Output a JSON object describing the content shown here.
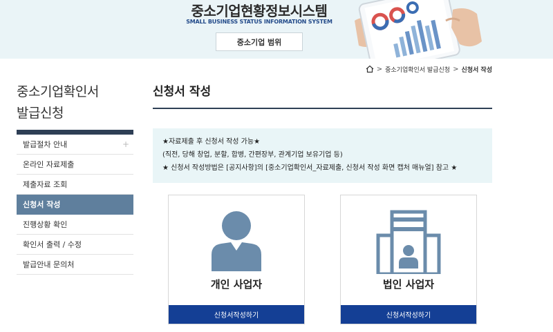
{
  "banner": {
    "title": "중소기업현황정보시스템",
    "subtitle": "SMALL BUSINESS STATUS INFORMATION SYSTEM",
    "scope_button": "중소기업 범위"
  },
  "breadcrumb": {
    "items": [
      "중소기업확인서 발급신청",
      "신청서 작성"
    ],
    "separator": ">"
  },
  "sidebar": {
    "title_line1": "중소기업확인서",
    "title_line2": "발급신청",
    "items": [
      {
        "label": "발급절차 안내",
        "has_plus": true
      },
      {
        "label": "온라인 자료제출"
      },
      {
        "label": "제출자료 조회"
      },
      {
        "label": "신청서 작성",
        "active": true
      },
      {
        "label": "진행상황 확인"
      },
      {
        "label": "확인서 출력 / 수정"
      },
      {
        "label": "발급안내 문의처"
      }
    ],
    "plus_glyph": "+"
  },
  "main": {
    "page_title": "신청서 작성",
    "notice": {
      "line1": "★자료제출 후 신청서 작성 가능★",
      "line2": "(직전, 당해 창업, 분할, 합병, 간편장부, 관계기업 보유기업 등)",
      "line3": "★ 신청서 작성방법은 [공지사항]의 [중소기업확인서_자료제출, 신청서 작성 화면 캡처 매뉴얼] 참고 ★"
    },
    "cards": [
      {
        "label": "개인 사업자",
        "button": "신청서작성하기",
        "icon": "person-icon"
      },
      {
        "label": "법인 사업자",
        "button": "신청서작성하기",
        "icon": "building-icon"
      }
    ]
  },
  "colors": {
    "banner_bg": "#eaf4f7",
    "nav_dark": "#2e3f55",
    "active_item": "#5f7f9d",
    "icon_blue": "#6b8cab",
    "button_blue": "#143f95",
    "notice_bg": "#e9f5f7"
  }
}
